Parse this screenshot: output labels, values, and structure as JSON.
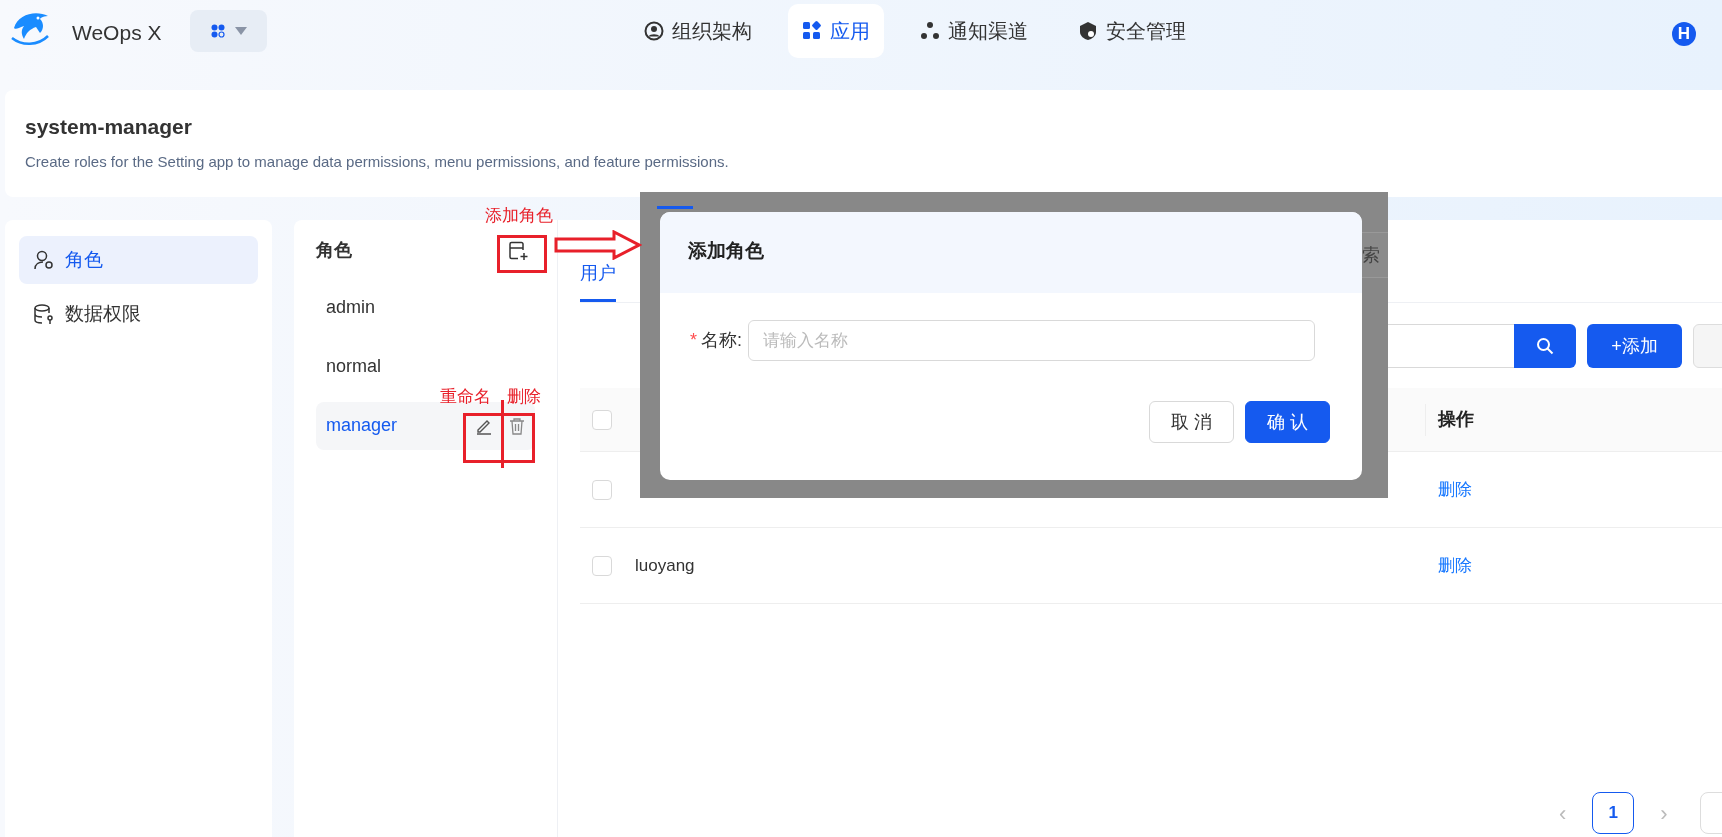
{
  "app": {
    "name": "WeOps X"
  },
  "nav": [
    {
      "label": "组织架构",
      "kind": "org",
      "selected": false
    },
    {
      "label": "应用",
      "kind": "apps",
      "selected": true
    },
    {
      "label": "通知渠道",
      "kind": "notify",
      "selected": false
    },
    {
      "label": "安全管理",
      "kind": "security",
      "selected": false
    }
  ],
  "avatar": "H",
  "header": {
    "title": "system-manager",
    "description": "Create roles for the Setting app to manage data permissions, menu permissions, and feature permissions."
  },
  "sidebar": {
    "items": [
      {
        "label": "角色",
        "kind": "role",
        "selected": true
      },
      {
        "label": "数据权限",
        "kind": "data",
        "selected": false
      }
    ]
  },
  "roles": {
    "title": "角色",
    "items": [
      {
        "label": "admin",
        "selected": false
      },
      {
        "label": "normal",
        "selected": false
      },
      {
        "label": "manager",
        "selected": true
      }
    ]
  },
  "tabs": [
    {
      "label": "用户",
      "selected": true
    }
  ],
  "toolbar": {
    "add_button": "+添加",
    "batch_button": {
      "disabled": true
    }
  },
  "table": {
    "select_all_checked": false,
    "columns": [
      "操作"
    ],
    "rows": [
      {
        "checked": false,
        "action": "删除"
      },
      {
        "checked": false,
        "name": "luoyang",
        "action": "删除"
      }
    ]
  },
  "pagination": {
    "prev": "‹",
    "pages": [
      {
        "label": "1",
        "selected": true
      }
    ],
    "next": "›"
  },
  "behind_dialog": {
    "search_hint": "索"
  },
  "dialog": {
    "title": "添加角色",
    "field": {
      "required_mark": "*",
      "label": "名称:",
      "placeholder": "请输入名称"
    },
    "buttons": [
      {
        "label": "取 消",
        "kind": "default"
      },
      {
        "label": "确 认",
        "kind": "primary"
      }
    ]
  },
  "annotations": [
    {
      "text": "添加角色",
      "kind": "add"
    },
    {
      "text": "重命名",
      "kind": "rename"
    },
    {
      "text": "删除",
      "kind": "delete"
    }
  ]
}
